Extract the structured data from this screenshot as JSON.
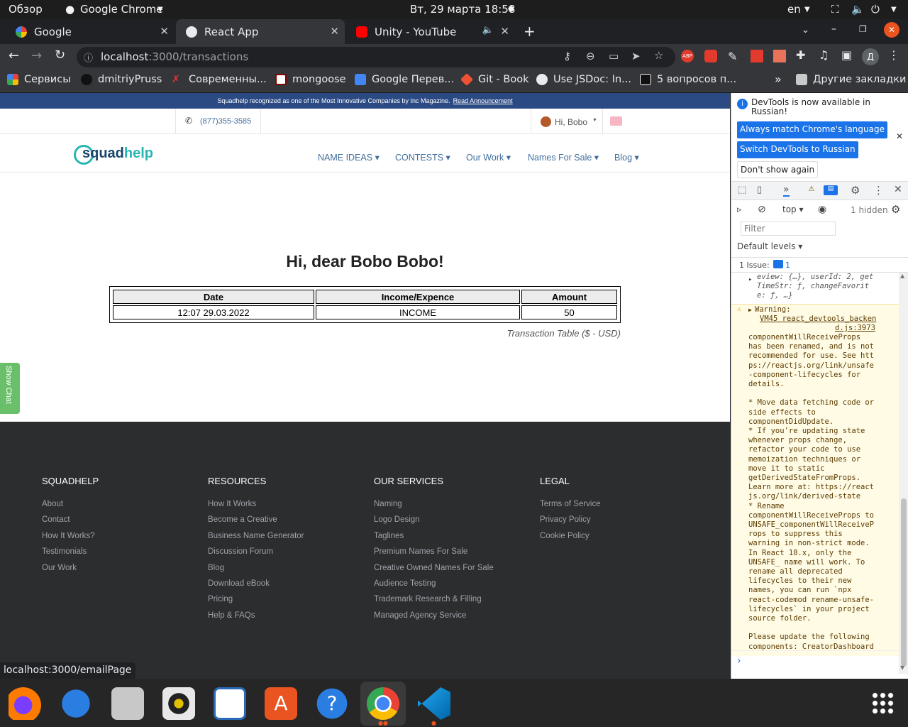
{
  "gnome": {
    "activities": "Обзор",
    "app": "Google Chrome",
    "clock": "Вт, 29 марта  18:58",
    "lang": "en"
  },
  "tabs": [
    {
      "title": "Google"
    },
    {
      "title": "React App"
    },
    {
      "title": "Unity - YouTube"
    }
  ],
  "omnibox": {
    "host": "localhost",
    "path": ":3000/transactions"
  },
  "bookmarks": [
    "Сервисы",
    "dmitriyPruss",
    "Современны...",
    "mongoose",
    "Google Перев...",
    "Git - Book",
    "Use JSDoc: In...",
    "5 вопросов п..."
  ],
  "bookmarks_overflow": "»",
  "other_bookmarks": "Другие закладки",
  "site": {
    "announce_text": "Squadhelp recognized as one of the Most Innovative Companies by Inc Magazine.",
    "announce_link": "Read Announcement",
    "phone": "(877)355-3585",
    "user_greeting": "Hi, Bobo",
    "logo_a": "squad",
    "logo_b": "help",
    "nav": [
      "NAME IDEAS",
      "CONTESTS",
      "Our Work",
      "Names For Sale",
      "Blog"
    ],
    "greeting": "Hi, dear Bobo Bobo!",
    "table": {
      "headers": [
        "Date",
        "Income/Expence",
        "Amount"
      ],
      "rows": [
        [
          "12:07 29.03.2022",
          "INCOME",
          "50"
        ]
      ]
    },
    "caption": "Transaction Table ($ - USD)",
    "show_chat": "Show Chat",
    "footer": [
      {
        "title": "SQUADHELP",
        "links": [
          "About",
          "Contact",
          "How It Works?",
          "Testimonials",
          "Our Work"
        ]
      },
      {
        "title": "RESOURCES",
        "links": [
          "How It Works",
          "Become a Creative",
          "Business Name Generator",
          "Discussion Forum",
          "Blog",
          "Download eBook",
          "Pricing",
          "Help & FAQs"
        ]
      },
      {
        "title": "OUR SERVICES",
        "links": [
          "Naming",
          "Logo Design",
          "Taglines",
          "Premium Names For Sale",
          "Creative Owned Names For Sale",
          "Audience Testing",
          "Trademark Research & Filling",
          "Managed Agency Service"
        ]
      },
      {
        "title": "LEGAL",
        "links": [
          "Terms of Service",
          "Privacy Policy",
          "Cookie Policy"
        ]
      }
    ]
  },
  "status_url": "localhost:3000/emailPage",
  "devtools": {
    "infobar_title": "DevTools is now available in Russian!",
    "btn_match": "Always match Chrome's language",
    "btn_switch": "Switch DevTools to Russian",
    "btn_dont": "Don't show again",
    "context": "top",
    "hidden": "1 hidden",
    "filter_placeholder": "Filter",
    "levels": "Default levels",
    "issues_label": "1 Issue:",
    "issues_count": "1",
    "console_lines": [
      "eview: {…}, userId: 2, get",
      "TimeStr: ƒ, changeFavorit",
      "e: ƒ, …}",
      "Warning:",
      "VM45 react_devtools_backen",
      "d.js:3973",
      "componentWillReceiveProps",
      "has been renamed, and is not",
      "recommended for use. See htt",
      "ps://reactjs.org/link/unsafe",
      "-component-lifecycles for",
      "details.",
      "",
      "* Move data fetching code or",
      "side effects to",
      "componentDidUpdate.",
      "* If you're updating state",
      "whenever props change,",
      "refactor your code to use",
      "memoization techniques or",
      "move it to static",
      "getDerivedStateFromProps.",
      "Learn more at: https://react",
      "js.org/link/derived-state",
      "* Rename",
      "componentWillReceiveProps to",
      "UNSAFE_componentWillReceiveP",
      "rops to suppress this",
      "warning in non-strict mode.",
      "In React 18.x, only the",
      "UNSAFE_ name will work. To",
      "rename all deprecated",
      "lifecycles to their new",
      "names, you can run `npx",
      "react-codemod rename-unsafe-",
      "lifecycles` in your project",
      "source folder.",
      "",
      "Please update the following",
      "components: CreatorDashboard"
    ],
    "prompt": "›"
  },
  "colors": {
    "accent": "#1a73e8",
    "site_blue": "#2b4a83",
    "footer_bg": "#2b2d2f",
    "chat_green": "#6ac06a"
  }
}
